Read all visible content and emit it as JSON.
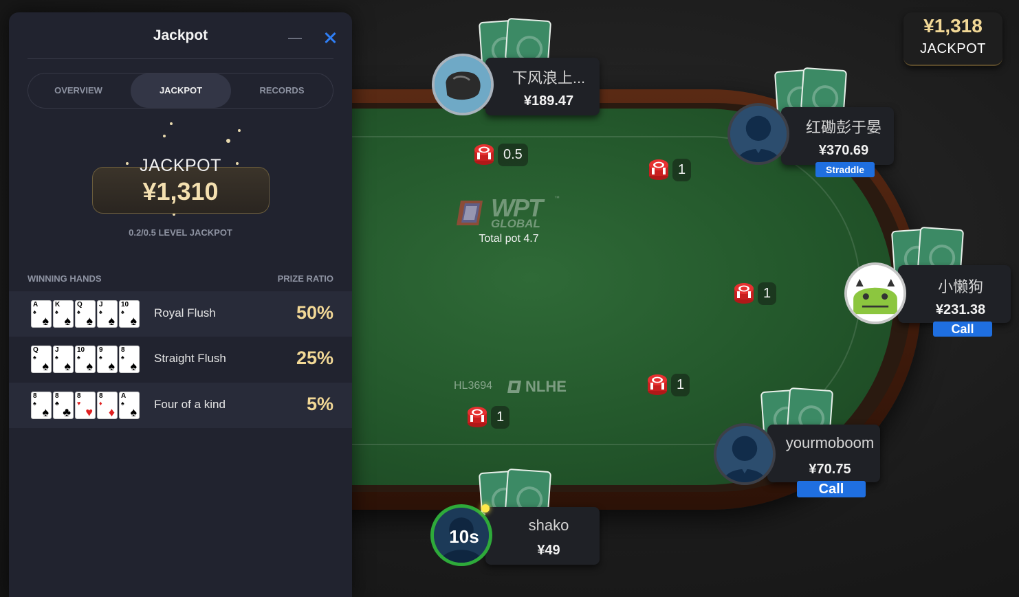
{
  "panel": {
    "title": "Jackpot",
    "tabs": [
      "OVERVIEW",
      "JACKPOT",
      "RECORDS"
    ],
    "active_tab": "JACKPOT",
    "jackpot_label": "JACKPOT",
    "jackpot_amount": "¥1,310",
    "level_label": "0.2/0.5 LEVEL JACKPOT",
    "col_hands": "WINNING HANDS",
    "col_ratio": "PRIZE RATIO",
    "hands": [
      {
        "name": "Royal Flush",
        "ratio": "50%",
        "cards": [
          [
            "A",
            "♠",
            "black"
          ],
          [
            "K",
            "♠",
            "black"
          ],
          [
            "Q",
            "♠",
            "black"
          ],
          [
            "J",
            "♠",
            "black"
          ],
          [
            "10",
            "♠",
            "black"
          ]
        ]
      },
      {
        "name": "Straight Flush",
        "ratio": "25%",
        "cards": [
          [
            "Q",
            "♠",
            "black"
          ],
          [
            "J",
            "♠",
            "black"
          ],
          [
            "10",
            "♠",
            "black"
          ],
          [
            "9",
            "♠",
            "black"
          ],
          [
            "8",
            "♠",
            "black"
          ]
        ]
      },
      {
        "name": "Four of a kind",
        "ratio": "5%",
        "cards": [
          [
            "8",
            "♠",
            "black"
          ],
          [
            "8",
            "♣",
            "black"
          ],
          [
            "8",
            "♥",
            "red"
          ],
          [
            "8",
            "♦",
            "red"
          ],
          [
            "A",
            "♠",
            "black"
          ]
        ]
      }
    ]
  },
  "jackpot_badge": {
    "amount": "¥1,318",
    "label": "JACKPOT"
  },
  "table": {
    "logo_text": "WPT",
    "logo_sub": "GLOBAL",
    "logo_tm": "™",
    "total_pot": "Total pot 4.7",
    "table_id": "HL3694",
    "game_type": "NLHE"
  },
  "bets": [
    "0.5",
    "1",
    "1",
    "1",
    "1"
  ],
  "players": [
    {
      "name": "下风浪上...",
      "stack": "¥189.47"
    },
    {
      "name": "红磡彭于晏",
      "stack": "¥370.69",
      "tag": "Straddle"
    },
    {
      "name": "小懒狗",
      "stack": "¥231.38",
      "tag": "Call"
    },
    {
      "name": "yourmoboom",
      "stack": "¥70.75",
      "tag": "Call"
    },
    {
      "name": "shako",
      "stack": "¥49",
      "timer": "10s"
    }
  ],
  "colors": {
    "accent": "#2f7ef5",
    "gold": "#f2d896",
    "felt": "#2a6132",
    "tag_blue": "#1f6fe0"
  }
}
